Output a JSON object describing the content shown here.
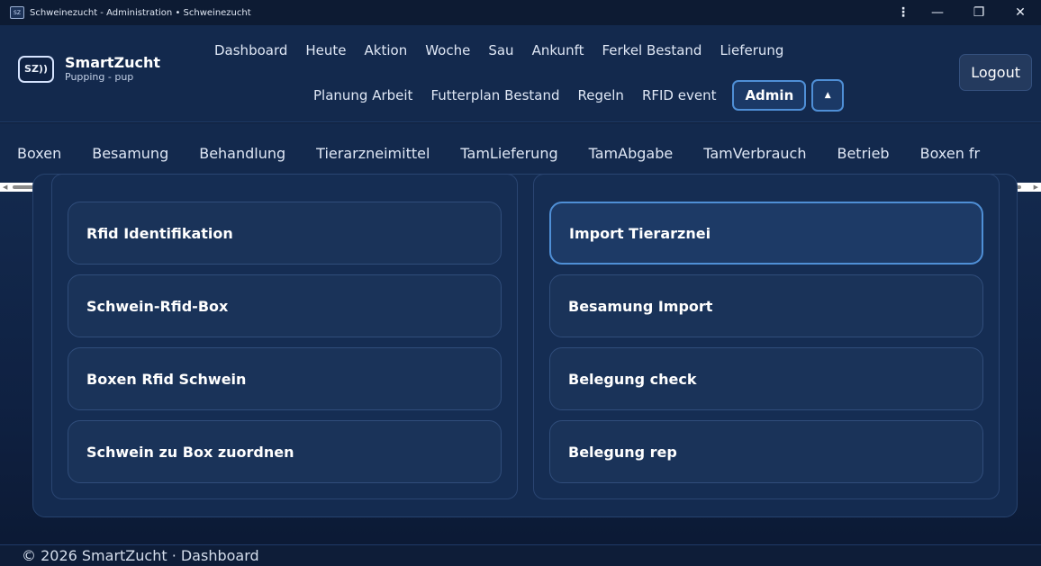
{
  "window": {
    "app_icon_text": "SZ",
    "title": "Schweinezucht - Administration • Schweinezucht",
    "menu_icon": "⋮",
    "minimize_icon": "—",
    "maximize_icon": "❐",
    "close_icon": "✕"
  },
  "brand": {
    "logo_text": "SZ))",
    "name": "SmartZucht",
    "subtitle": "Pupping - pup"
  },
  "nav": {
    "row1": [
      "Dashboard",
      "Heute",
      "Aktion",
      "Woche",
      "Sau",
      "Ankunft",
      "Ferkel Bestand",
      "Lieferung"
    ],
    "row2": [
      "Planung Arbeit",
      "Futterplan Bestand",
      "Regeln",
      "RFID event"
    ],
    "active": "Admin",
    "toggle_icon": "▲",
    "logout": "Logout"
  },
  "subnav": {
    "items": [
      "Boxen",
      "Besamung",
      "Behandlung",
      "Tierarzneimittel",
      "TamLieferung",
      "TamAbgabe",
      "TamVerbrauch",
      "Betrieb",
      "Boxen fr"
    ]
  },
  "cards": {
    "left": [
      "Rfid Identifikation",
      "Schwein-Rfid-Box",
      "Boxen Rfid Schwein",
      "Schwein zu Box zuordnen"
    ],
    "right": [
      "Import Tierarznei",
      "Besamung Import",
      "Belegung check",
      "Belegung rep"
    ]
  },
  "footer": {
    "text": "© 2026 SmartZucht · Dashboard"
  },
  "colors": {
    "background": "#0f1f3a",
    "header": "#13294d",
    "accent": "#4f8fd6",
    "card": "#1a3359"
  }
}
